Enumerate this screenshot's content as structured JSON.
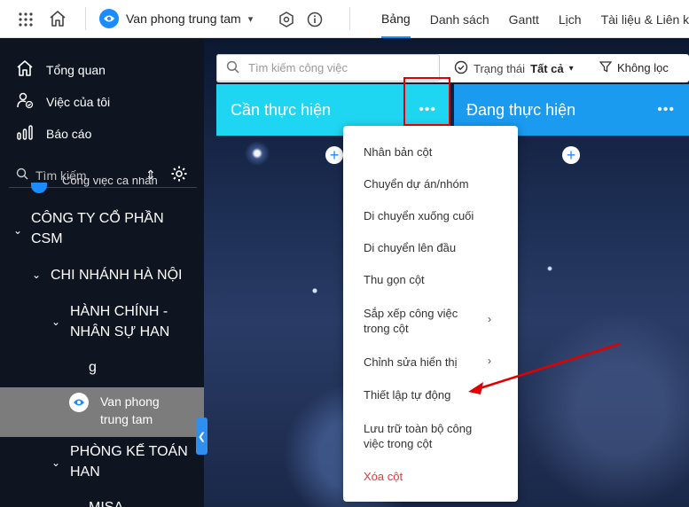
{
  "topbar": {
    "workspace_name": "Van phong trung tam",
    "tabs": [
      {
        "label": "Bảng",
        "active": true
      },
      {
        "label": "Danh sách",
        "active": false
      },
      {
        "label": "Gantt",
        "active": false
      },
      {
        "label": "Lịch",
        "active": false
      },
      {
        "label": "Tài liệu & Liên kết",
        "active": false
      }
    ]
  },
  "sidebar": {
    "nav": [
      {
        "label": "Tổng quan",
        "icon": "home-icon"
      },
      {
        "label": "Việc của tôi",
        "icon": "user-check-icon"
      },
      {
        "label": "Báo cáo",
        "icon": "bar-chart-icon"
      }
    ],
    "search_placeholder": "Tìm kiếm",
    "tree": {
      "personal_label": "Công việc cá nhân",
      "company": [
        "CÔNG TY CỔ PHẦN",
        "CSM"
      ],
      "branch": "CHI NHÁNH HÀ NỘI",
      "dept1": [
        "HÀNH CHÍNH -",
        "NHÂN SỰ HAN",
        "g"
      ],
      "selected": [
        "Van phong",
        "trung tam"
      ],
      "dept2": [
        "PHÒNG KẾ TOÁN",
        "HAN"
      ],
      "dept3": "MISA"
    }
  },
  "board": {
    "search_placeholder": "Tìm kiếm công việc",
    "status_label": "Trạng thái",
    "status_value": "Tất cả",
    "filter_label": "Không lọc",
    "columns": [
      {
        "title": "Cần thực hiện",
        "color": "#1fd6f2"
      },
      {
        "title": "Đang thực hiện",
        "color": "#1a9bf0"
      }
    ]
  },
  "context_menu": {
    "items": [
      {
        "label": "Nhân bản cột"
      },
      {
        "label": "Chuyển dự án/nhóm"
      },
      {
        "label": "Di chuyển xuống cuối"
      },
      {
        "label": "Di chuyển lên đầu"
      },
      {
        "label": "Thu gọn cột"
      },
      {
        "label": "Sắp xếp công việc trong cột",
        "submenu": true
      },
      {
        "label": "Chỉnh sửa hiển thị",
        "submenu": true
      },
      {
        "label": "Thiết lập tự động"
      },
      {
        "label": "Lưu trữ toàn bộ công việc trong cột"
      },
      {
        "label": "Xóa cột",
        "danger": true
      }
    ]
  },
  "colors": {
    "accent": "#1a8cff",
    "annotation": "#e00000",
    "danger": "#e03a3a"
  }
}
